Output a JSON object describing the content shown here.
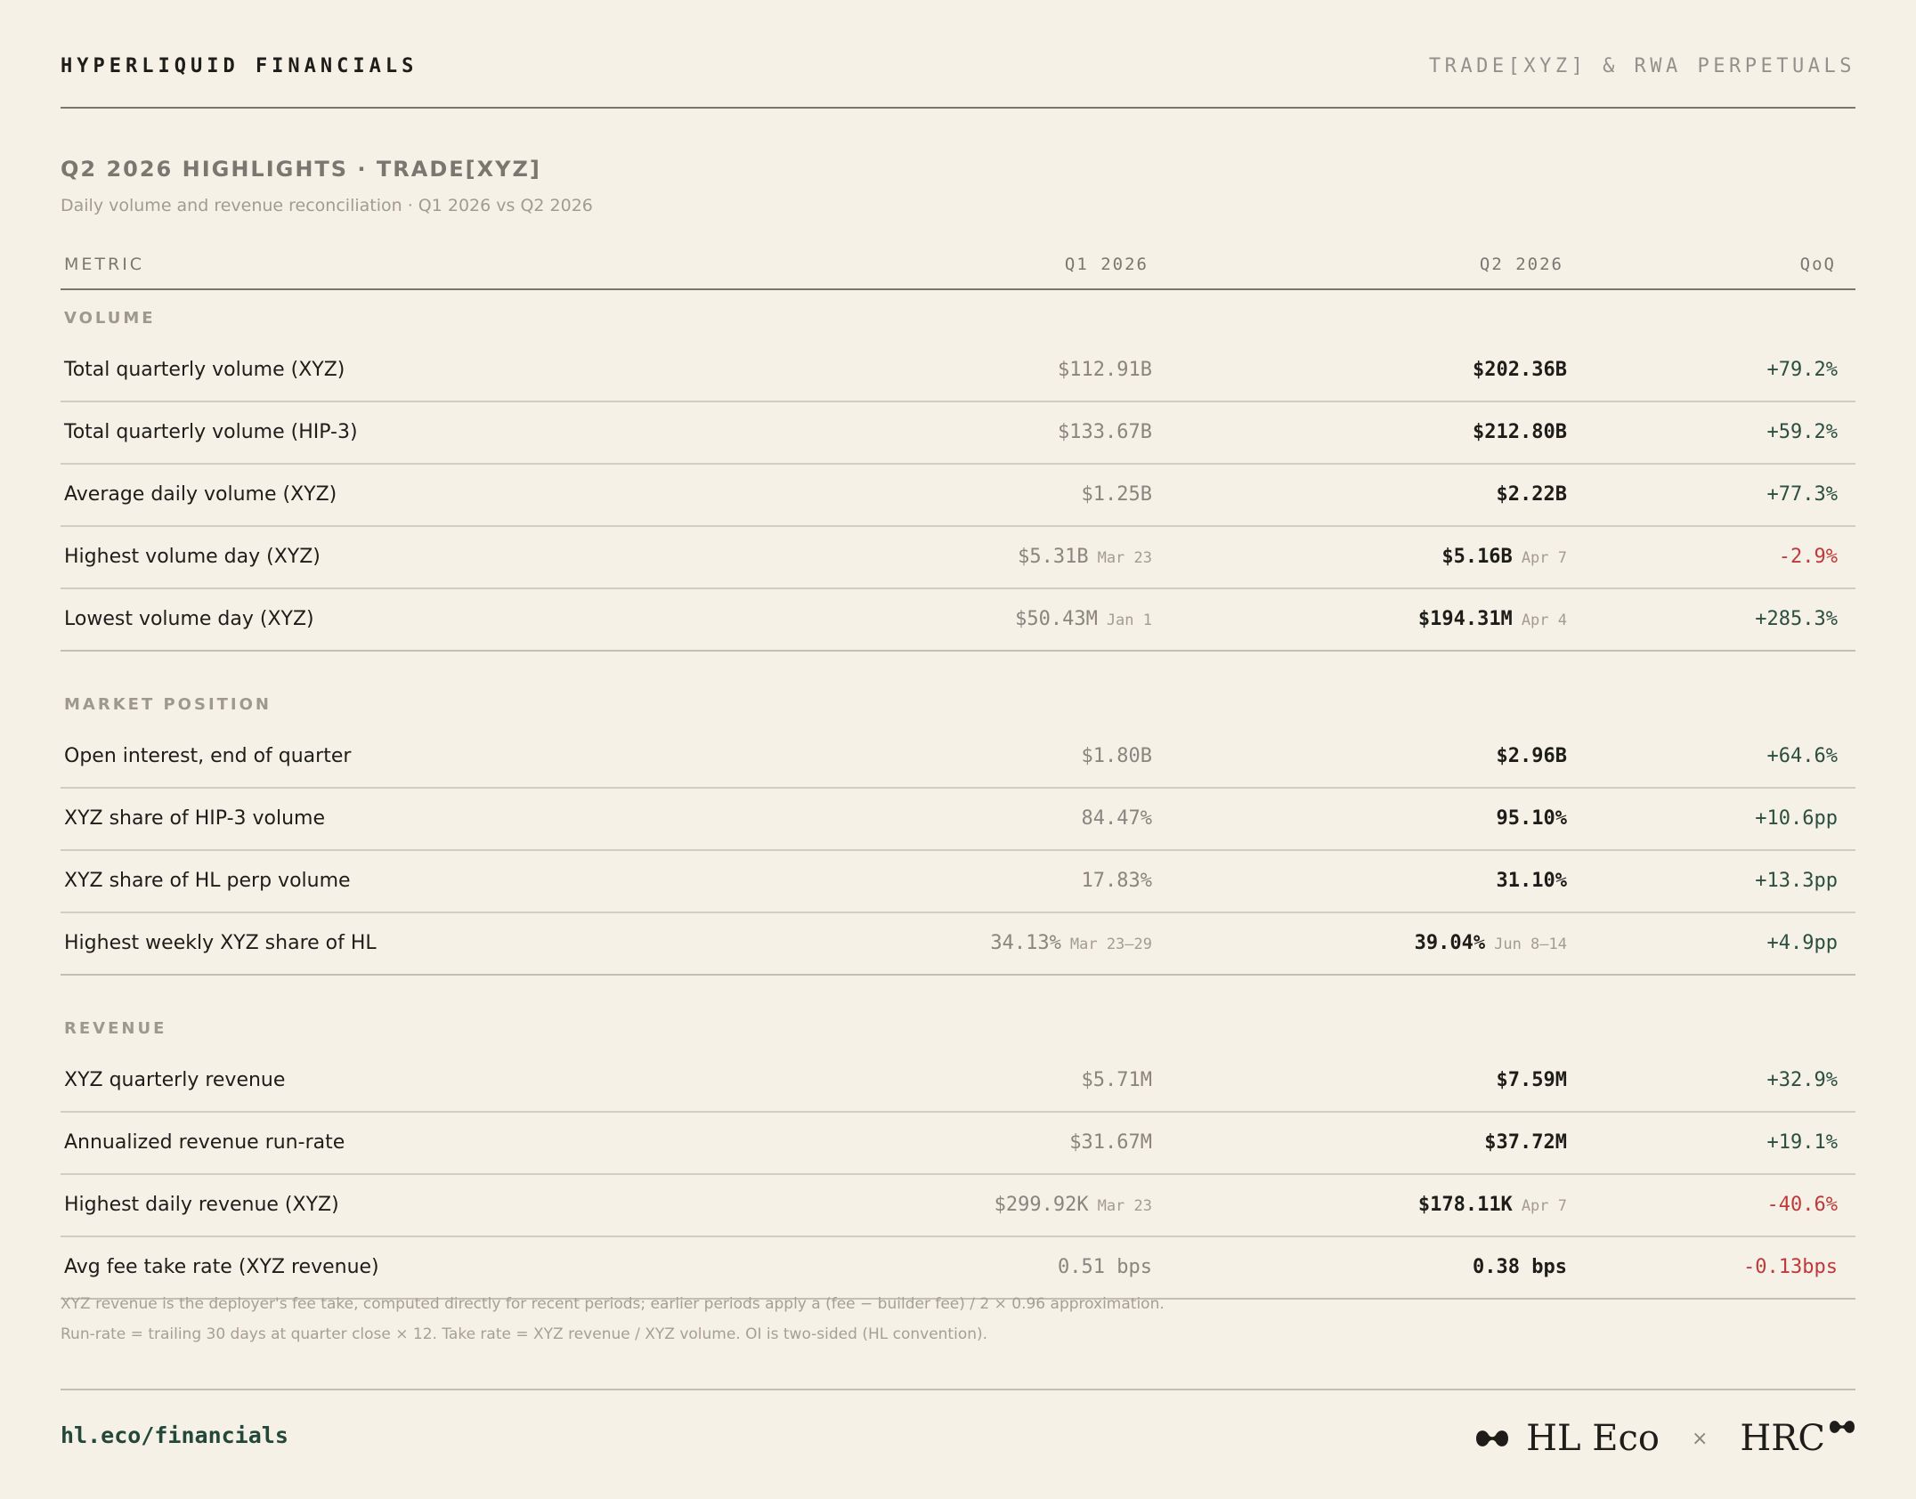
{
  "header": {
    "brand": "HYPERLIQUID FINANCIALS",
    "tagline": "TRADE[XYZ] & RWA PERPETUALS"
  },
  "title": "Q2 2026 HIGHLIGHTS · TRADE[XYZ]",
  "subtitle": "Daily volume and revenue reconciliation · Q1 2026 vs Q2 2026",
  "columns": {
    "metric": "METRIC",
    "q1": "Q1 2026",
    "q2": "Q2 2026",
    "qoq": "QoQ"
  },
  "sections": [
    {
      "label": "VOLUME",
      "rows": [
        {
          "label": "Total quarterly volume (XYZ)",
          "q1": "$112.91B",
          "q1_date": "",
          "q2": "$202.36B",
          "q2_date": "",
          "qoq": "+79.2%",
          "trend": "pos"
        },
        {
          "label": "Total quarterly volume (HIP-3)",
          "q1": "$133.67B",
          "q1_date": "",
          "q2": "$212.80B",
          "q2_date": "",
          "qoq": "+59.2%",
          "trend": "pos"
        },
        {
          "label": "Average daily volume (XYZ)",
          "q1": "$1.25B",
          "q1_date": "",
          "q2": "$2.22B",
          "q2_date": "",
          "qoq": "+77.3%",
          "trend": "pos"
        },
        {
          "label": "Highest volume day (XYZ)",
          "q1": "$5.31B",
          "q1_date": "Mar 23",
          "q2": "$5.16B",
          "q2_date": "Apr 7",
          "qoq": "-2.9%",
          "trend": "neg"
        },
        {
          "label": "Lowest volume day (XYZ)",
          "q1": "$50.43M",
          "q1_date": "Jan 1",
          "q2": "$194.31M",
          "q2_date": "Apr 4",
          "qoq": "+285.3%",
          "trend": "pos"
        }
      ]
    },
    {
      "label": "MARKET POSITION",
      "rows": [
        {
          "label": "Open interest, end of quarter",
          "q1": "$1.80B",
          "q1_date": "",
          "q2": "$2.96B",
          "q2_date": "",
          "qoq": "+64.6%",
          "trend": "pos"
        },
        {
          "label": "XYZ share of HIP-3 volume",
          "q1": "84.47%",
          "q1_date": "",
          "q2": "95.10%",
          "q2_date": "",
          "qoq": "+10.6pp",
          "trend": "pos"
        },
        {
          "label": "XYZ share of HL perp volume",
          "q1": "17.83%",
          "q1_date": "",
          "q2": "31.10%",
          "q2_date": "",
          "qoq": "+13.3pp",
          "trend": "pos"
        },
        {
          "label": "Highest weekly XYZ share of HL",
          "q1": "34.13%",
          "q1_date": "Mar 23–29",
          "q2": "39.04%",
          "q2_date": "Jun 8–14",
          "qoq": "+4.9pp",
          "trend": "pos"
        }
      ]
    },
    {
      "label": "REVENUE",
      "rows": [
        {
          "label": "XYZ quarterly revenue",
          "q1": "$5.71M",
          "q1_date": "",
          "q2": "$7.59M",
          "q2_date": "",
          "qoq": "+32.9%",
          "trend": "pos"
        },
        {
          "label": "Annualized revenue run-rate",
          "q1": "$31.67M",
          "q1_date": "",
          "q2": "$37.72M",
          "q2_date": "",
          "qoq": "+19.1%",
          "trend": "pos"
        },
        {
          "label": "Highest daily revenue (XYZ)",
          "q1": "$299.92K",
          "q1_date": "Mar 23",
          "q2": "$178.11K",
          "q2_date": "Apr 7",
          "qoq": "-40.6%",
          "trend": "neg"
        },
        {
          "label": "Avg fee take rate (XYZ revenue)",
          "q1": "0.51 bps",
          "q1_date": "",
          "q2": "0.38 bps",
          "q2_date": "",
          "qoq": "-0.13bps",
          "trend": "neg"
        }
      ]
    }
  ],
  "notes": [
    "XYZ revenue is the deployer's fee take, computed directly for recent periods; earlier periods apply a (fee − builder fee) / 2 × 0.96 approximation.",
    "Run-rate = trailing 30 days at quarter close × 12. Take rate = XYZ revenue / XYZ volume. OI is two-sided (HL convention)."
  ],
  "footer": {
    "url": "hl.eco/financials",
    "logo_primary": "HL Eco",
    "separator": "×",
    "logo_secondary": "HRC"
  },
  "colors": {
    "background": "#f5f1e6",
    "positive": "#2c4f40",
    "negative": "#c0393a"
  }
}
